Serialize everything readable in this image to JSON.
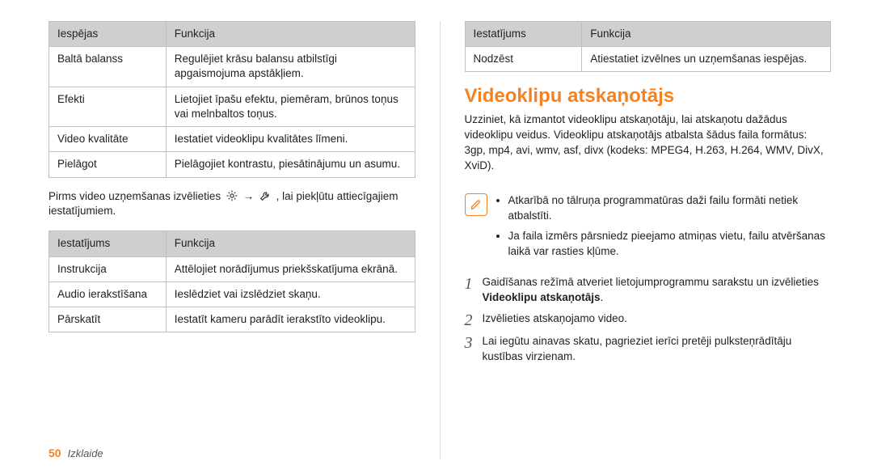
{
  "left": {
    "table1": {
      "headers": [
        "Iespējas",
        "Funkcija"
      ],
      "rows": [
        [
          "Baltā balanss",
          "Regulējiet krāsu balansu atbilstīgi apgaismojuma apstākļiem."
        ],
        [
          "Efekti",
          "Lietojiet īpašu efektu, piemēram, brūnos toņus vai melnbaltos toņus."
        ],
        [
          "Video kvalitāte",
          "Iestatiet videoklipu kvalitātes līmeni."
        ],
        [
          "Pielāgot",
          "Pielāgojiet kontrastu, piesātinājumu un asumu."
        ]
      ]
    },
    "paragraph_before": "Pirms video uzņemšanas izvēlieties ",
    "paragraph_arrow": " → ",
    "paragraph_after": ", lai piekļūtu attiecīgajiem iestatījumiem.",
    "table2": {
      "headers": [
        "Iestatījums",
        "Funkcija"
      ],
      "rows": [
        [
          "Instrukcija",
          "Attēlojiet norādījumus priekšskatījuma ekrānā."
        ],
        [
          "Audio ierakstīšana",
          "Ieslēdziet vai izslēdziet skaņu."
        ],
        [
          "Pārskatīt",
          "Iestatīt kameru parādīt ierakstīto videoklipu."
        ]
      ]
    }
  },
  "right": {
    "table3": {
      "headers": [
        "Iestatījums",
        "Funkcija"
      ],
      "rows": [
        [
          "Nodzēst",
          "Atiestatiet izvēlnes un uzņemšanas iespējas."
        ]
      ]
    },
    "title": "Videoklipu atskaņotājs",
    "intro": "Uzziniet, kā izmantot videoklipu atskaņotāju, lai atskaņotu dažādus videoklipu veidus. Videoklipu atskaņotājs atbalsta šādus faila formātus: 3gp, mp4, avi, wmv, asf, divx (kodeks: MPEG4, H.263, H.264, WMV, DivX, XviD).",
    "notes": [
      "Atkarībā no tālruņa programmatūras daži failu formāti netiek atbalstīti.",
      "Ja faila izmērs pārsniedz pieejamo atmiņas vietu, failu atvēršanas laikā var rasties kļūme."
    ],
    "steps": [
      {
        "num": "1",
        "pre": "Gaidīšanas režīmā atveriet lietojumprogrammu sarakstu un izvēlieties ",
        "bold": "Videoklipu atskaņotājs",
        "post": "."
      },
      {
        "num": "2",
        "pre": "Izvēlieties atskaņojamo video.",
        "bold": "",
        "post": ""
      },
      {
        "num": "3",
        "pre": "Lai iegūtu ainavas skatu, pagrieziet ierīci pretēji pulksteņrādītāju kustības virzienam.",
        "bold": "",
        "post": ""
      }
    ]
  },
  "footer": {
    "page": "50",
    "section": "Izklaide"
  }
}
